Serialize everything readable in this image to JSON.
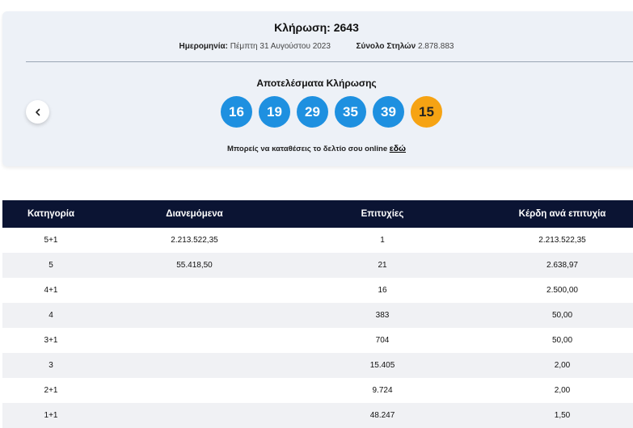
{
  "draw": {
    "title": "Κλήρωση: 2643",
    "date_label": "Ημερομηνία:",
    "date_value": "Πέμπτη 31 Αυγούστου 2023",
    "columns_label": "Σύνολο Στηλών",
    "columns_value": "2.878.883"
  },
  "results": {
    "title": "Αποτελέσματα Κλήρωσης",
    "numbers": [
      "16",
      "19",
      "29",
      "35",
      "39"
    ],
    "bonus": "15",
    "online_text": "Μπορείς να καταθέσεις το δελτίο σου online",
    "online_link": "εδώ",
    "prev_icon": "chevron-left-icon"
  },
  "colors": {
    "ball": "#1e90e0",
    "bonus_ball": "#f6a313",
    "table_header": "#0b1433",
    "card": "#edf1f7"
  },
  "table": {
    "headers": [
      "Κατηγορία",
      "Διανεμόμενα",
      "Επιτυχίες",
      "Κέρδη ανά επιτυχία"
    ],
    "rows": [
      [
        "5+1",
        "2.213.522,35",
        "1",
        "2.213.522,35"
      ],
      [
        "5",
        "55.418,50",
        "21",
        "2.638,97"
      ],
      [
        "4+1",
        "",
        "16",
        "2.500,00"
      ],
      [
        "4",
        "",
        "383",
        "50,00"
      ],
      [
        "3+1",
        "",
        "704",
        "50,00"
      ],
      [
        "3",
        "",
        "15.405",
        "2,00"
      ],
      [
        "2+1",
        "",
        "9.724",
        "2,00"
      ],
      [
        "1+1",
        "",
        "48.247",
        "1,50"
      ]
    ]
  }
}
